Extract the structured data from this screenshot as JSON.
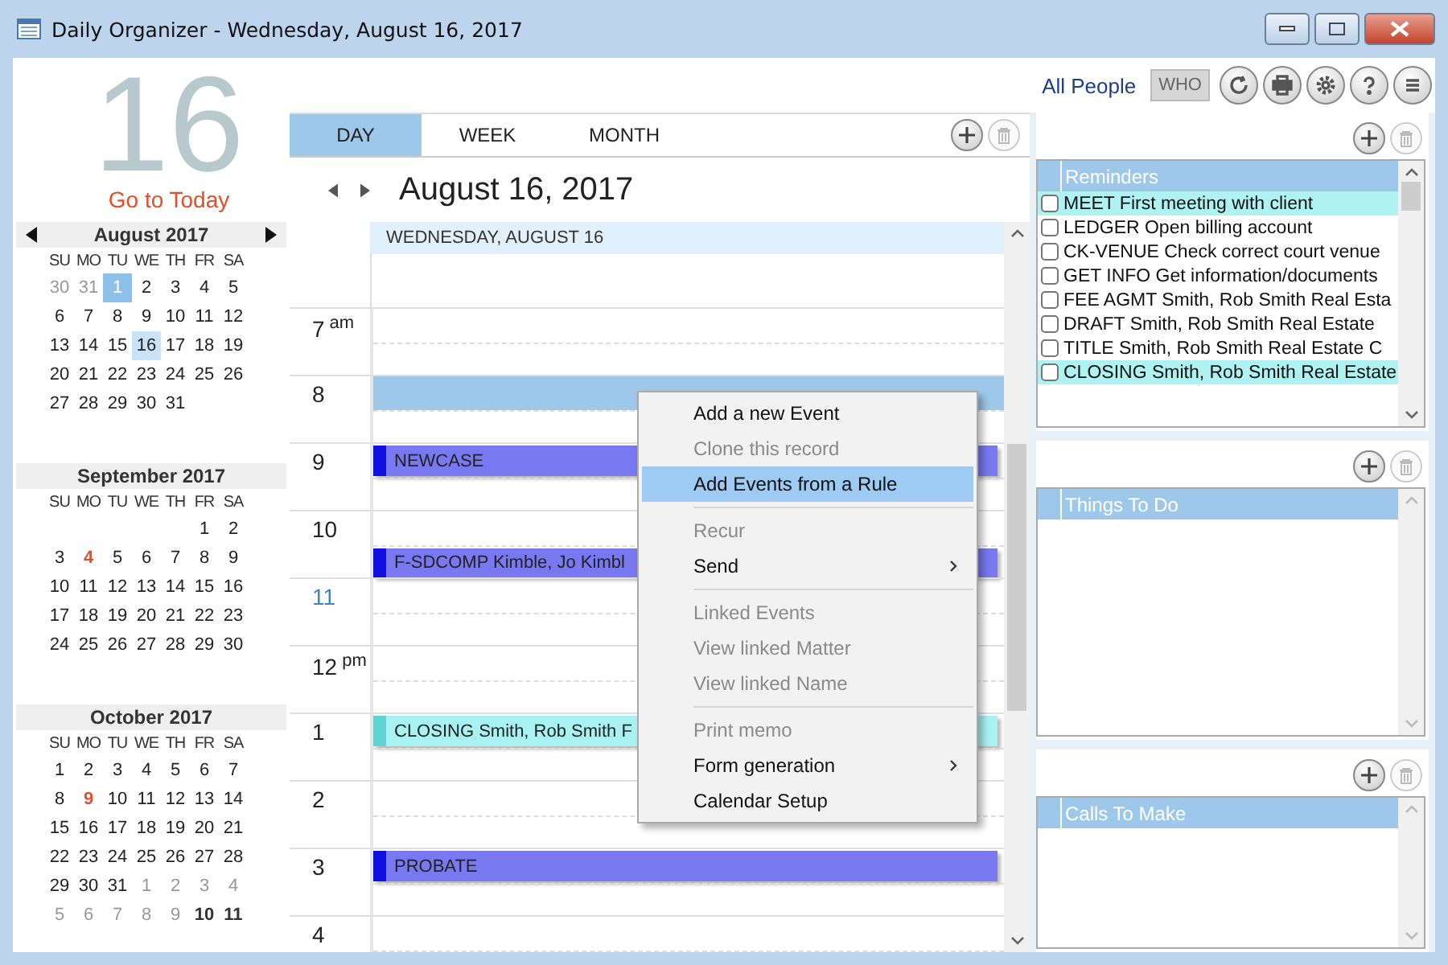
{
  "window": {
    "title": "Daily Organizer - Wednesday, August 16, 2017"
  },
  "toolbar": {
    "people_link": "All People",
    "who_button": "WHO"
  },
  "sidebar": {
    "big_day": "16",
    "today_link": "Go to Today",
    "months": [
      {
        "title": "August 2017",
        "arrows": true,
        "weekdays": [
          "SU",
          "MO",
          "TU",
          "WE",
          "TH",
          "FR",
          "SA"
        ],
        "weeks": [
          [
            {
              "label": "30",
              "kind": "other"
            },
            {
              "label": "31",
              "kind": "other"
            },
            {
              "label": "1",
              "kind": "highlight"
            },
            {
              "label": "2",
              "kind": "day"
            },
            {
              "label": "3",
              "kind": "day"
            },
            {
              "label": "4",
              "kind": "day"
            },
            {
              "label": "5",
              "kind": "day"
            }
          ],
          [
            {
              "label": "6",
              "kind": "day"
            },
            {
              "label": "7",
              "kind": "day"
            },
            {
              "label": "8",
              "kind": "day"
            },
            {
              "label": "9",
              "kind": "day"
            },
            {
              "label": "10",
              "kind": "day"
            },
            {
              "label": "11",
              "kind": "day"
            },
            {
              "label": "12",
              "kind": "day"
            }
          ],
          [
            {
              "label": "13",
              "kind": "day"
            },
            {
              "label": "14",
              "kind": "day"
            },
            {
              "label": "15",
              "kind": "day"
            },
            {
              "label": "16",
              "kind": "selected"
            },
            {
              "label": "17",
              "kind": "day"
            },
            {
              "label": "18",
              "kind": "day"
            },
            {
              "label": "19",
              "kind": "day"
            }
          ],
          [
            {
              "label": "20",
              "kind": "day"
            },
            {
              "label": "21",
              "kind": "day"
            },
            {
              "label": "22",
              "kind": "day"
            },
            {
              "label": "23",
              "kind": "day"
            },
            {
              "label": "24",
              "kind": "day"
            },
            {
              "label": "25",
              "kind": "day"
            },
            {
              "label": "26",
              "kind": "day"
            }
          ],
          [
            {
              "label": "27",
              "kind": "day"
            },
            {
              "label": "28",
              "kind": "day"
            },
            {
              "label": "29",
              "kind": "day"
            },
            {
              "label": "30",
              "kind": "day"
            },
            {
              "label": "31",
              "kind": "day"
            }
          ]
        ]
      },
      {
        "title": "September 2017",
        "arrows": false,
        "weekdays": [
          "SU",
          "MO",
          "TU",
          "WE",
          "TH",
          "FR",
          "SA"
        ],
        "weeks": [
          [
            {
              "kind": "blank"
            },
            {
              "kind": "blank"
            },
            {
              "kind": "blank"
            },
            {
              "kind": "blank"
            },
            {
              "kind": "blank"
            },
            {
              "label": "1",
              "kind": "day"
            },
            {
              "label": "2",
              "kind": "day"
            }
          ],
          [
            {
              "label": "3",
              "kind": "day"
            },
            {
              "label": "4",
              "kind": "holiday"
            },
            {
              "label": "5",
              "kind": "day"
            },
            {
              "label": "6",
              "kind": "day"
            },
            {
              "label": "7",
              "kind": "day"
            },
            {
              "label": "8",
              "kind": "day"
            },
            {
              "label": "9",
              "kind": "day"
            }
          ],
          [
            {
              "label": "10",
              "kind": "day"
            },
            {
              "label": "11",
              "kind": "day"
            },
            {
              "label": "12",
              "kind": "day"
            },
            {
              "label": "13",
              "kind": "day"
            },
            {
              "label": "14",
              "kind": "day"
            },
            {
              "label": "15",
              "kind": "day"
            },
            {
              "label": "16",
              "kind": "day"
            }
          ],
          [
            {
              "label": "17",
              "kind": "day"
            },
            {
              "label": "18",
              "kind": "day"
            },
            {
              "label": "19",
              "kind": "day"
            },
            {
              "label": "20",
              "kind": "day"
            },
            {
              "label": "21",
              "kind": "day"
            },
            {
              "label": "22",
              "kind": "day"
            },
            {
              "label": "23",
              "kind": "day"
            }
          ],
          [
            {
              "label": "24",
              "kind": "day"
            },
            {
              "label": "25",
              "kind": "day"
            },
            {
              "label": "26",
              "kind": "day"
            },
            {
              "label": "27",
              "kind": "day"
            },
            {
              "label": "28",
              "kind": "day"
            },
            {
              "label": "29",
              "kind": "day"
            },
            {
              "label": "30",
              "kind": "day"
            }
          ]
        ]
      },
      {
        "title": "October 2017",
        "arrows": false,
        "weekdays": [
          "SU",
          "MO",
          "TU",
          "WE",
          "TH",
          "FR",
          "SA"
        ],
        "weeks": [
          [
            {
              "label": "1",
              "kind": "day"
            },
            {
              "label": "2",
              "kind": "day"
            },
            {
              "label": "3",
              "kind": "day"
            },
            {
              "label": "4",
              "kind": "day"
            },
            {
              "label": "5",
              "kind": "day"
            },
            {
              "label": "6",
              "kind": "day"
            },
            {
              "label": "7",
              "kind": "day"
            }
          ],
          [
            {
              "label": "8",
              "kind": "day"
            },
            {
              "label": "9",
              "kind": "holiday"
            },
            {
              "label": "10",
              "kind": "day"
            },
            {
              "label": "11",
              "kind": "day"
            },
            {
              "label": "12",
              "kind": "day"
            },
            {
              "label": "13",
              "kind": "day"
            },
            {
              "label": "14",
              "kind": "day"
            }
          ],
          [
            {
              "label": "15",
              "kind": "day"
            },
            {
              "label": "16",
              "kind": "day"
            },
            {
              "label": "17",
              "kind": "day"
            },
            {
              "label": "18",
              "kind": "day"
            },
            {
              "label": "19",
              "kind": "day"
            },
            {
              "label": "20",
              "kind": "day"
            },
            {
              "label": "21",
              "kind": "day"
            }
          ],
          [
            {
              "label": "22",
              "kind": "day"
            },
            {
              "label": "23",
              "kind": "day"
            },
            {
              "label": "24",
              "kind": "day"
            },
            {
              "label": "25",
              "kind": "day"
            },
            {
              "label": "26",
              "kind": "day"
            },
            {
              "label": "27",
              "kind": "day"
            },
            {
              "label": "28",
              "kind": "day"
            }
          ],
          [
            {
              "label": "29",
              "kind": "day"
            },
            {
              "label": "30",
              "kind": "day"
            },
            {
              "label": "31",
              "kind": "day"
            },
            {
              "label": "1",
              "kind": "other"
            },
            {
              "label": "2",
              "kind": "other"
            },
            {
              "label": "3",
              "kind": "other"
            },
            {
              "label": "4",
              "kind": "other"
            }
          ],
          [
            {
              "label": "5",
              "kind": "other"
            },
            {
              "label": "6",
              "kind": "other"
            },
            {
              "label": "7",
              "kind": "other"
            },
            {
              "label": "8",
              "kind": "other"
            },
            {
              "label": "9",
              "kind": "other"
            },
            {
              "label": "10",
              "kind": "bold"
            },
            {
              "label": "11",
              "kind": "bold"
            }
          ]
        ]
      }
    ]
  },
  "calendar": {
    "tabs": [
      {
        "label": "DAY",
        "selected": true
      },
      {
        "label": "WEEK",
        "selected": false
      },
      {
        "label": "MONTH",
        "selected": false
      }
    ],
    "date_title": "August 16, 2017",
    "day_header": "WEDNESDAY, AUGUST 16",
    "hours": [
      {
        "label": "7",
        "suffix": "am",
        "current": false
      },
      {
        "label": "8",
        "current": false,
        "top": {
          "kind": "selection"
        }
      },
      {
        "label": "9",
        "current": false,
        "top": {
          "kind": "event",
          "text": "NEWCASE",
          "color": "#7878f0"
        }
      },
      {
        "label": "10",
        "current": false,
        "bottom": {
          "kind": "event",
          "text": "F-SDCOMP Kimble, Jo Kimbl",
          "color": "#7878f0"
        }
      },
      {
        "label": "11",
        "current": true
      },
      {
        "label": "12",
        "suffix": "pm",
        "current": false
      },
      {
        "label": "1",
        "current": false,
        "top": {
          "kind": "event",
          "text": "CLOSING Smith, Rob Smith F",
          "color": "#a8f2f2"
        }
      },
      {
        "label": "2",
        "current": false
      },
      {
        "label": "3",
        "current": false,
        "top": {
          "kind": "event",
          "text": "PROBATE",
          "color": "#7878f0"
        }
      },
      {
        "label": "4",
        "current": false
      }
    ]
  },
  "context_menu": [
    {
      "kind": "item",
      "label": "Add a new Event",
      "disabled": false,
      "selected": false,
      "submenu": false
    },
    {
      "kind": "item",
      "label": "Clone this record",
      "disabled": true,
      "selected": false,
      "submenu": false
    },
    {
      "kind": "item",
      "label": "Add Events from a Rule",
      "disabled": false,
      "selected": true,
      "submenu": false
    },
    {
      "kind": "separator"
    },
    {
      "kind": "item",
      "label": "Recur",
      "disabled": true,
      "selected": false,
      "submenu": false
    },
    {
      "kind": "item",
      "label": "Send",
      "disabled": false,
      "selected": false,
      "submenu": true
    },
    {
      "kind": "separator"
    },
    {
      "kind": "item",
      "label": "Linked Events",
      "disabled": true,
      "selected": false,
      "submenu": false
    },
    {
      "kind": "item",
      "label": "View linked Matter",
      "disabled": true,
      "selected": false,
      "submenu": false
    },
    {
      "kind": "item",
      "label": "View linked Name",
      "disabled": true,
      "selected": false,
      "submenu": false
    },
    {
      "kind": "separator"
    },
    {
      "kind": "item",
      "label": "Print memo",
      "disabled": true,
      "selected": false,
      "submenu": false
    },
    {
      "kind": "item",
      "label": "Form generation",
      "disabled": false,
      "selected": false,
      "submenu": true
    },
    {
      "kind": "item",
      "label": "Calendar Setup",
      "disabled": false,
      "selected": false,
      "submenu": false
    }
  ],
  "panels": [
    {
      "title": "Reminders",
      "rows": [
        {
          "text": "MEET First meeting with client",
          "checked": false,
          "highlighted": true
        },
        {
          "text": "LEDGER Open billing account",
          "checked": false,
          "highlighted": false
        },
        {
          "text": "CK-VENUE Check correct court venue",
          "checked": false,
          "highlighted": false
        },
        {
          "text": "GET INFO Get information/documents",
          "checked": false,
          "highlighted": false
        },
        {
          "text": "FEE AGMT Smith, Rob Smith Real Esta",
          "checked": false,
          "highlighted": false
        },
        {
          "text": "DRAFT Smith, Rob Smith Real Estate",
          "checked": false,
          "highlighted": false
        },
        {
          "text": "TITLE Smith, Rob Smith Real Estate C",
          "checked": false,
          "highlighted": false
        },
        {
          "text": "CLOSING Smith, Rob Smith Real Estate",
          "checked": false,
          "highlighted": true
        }
      ]
    },
    {
      "title": "Things To Do"
    },
    {
      "title": "Calls To Make"
    }
  ]
}
